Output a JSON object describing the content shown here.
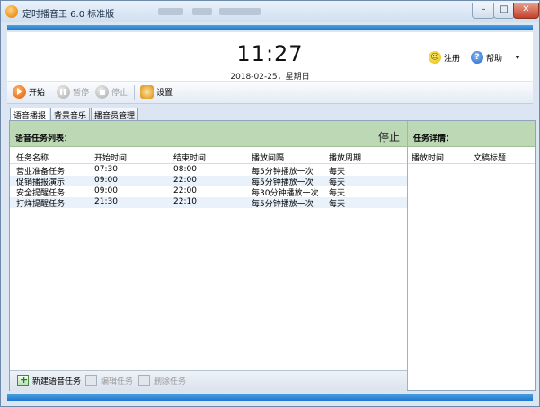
{
  "window": {
    "title": "定时播音王 6.0 标准版",
    "controls": {
      "minimize": "–",
      "maximize": "□",
      "close": "✕"
    }
  },
  "header": {
    "time": "11:27",
    "date": "2018-02-25，星期日",
    "register_label": "注册",
    "help_label": "帮助"
  },
  "toolbar": {
    "start_label": "开始",
    "pause_label": "暂停",
    "stop_label": "停止",
    "settings_label": "设置"
  },
  "tabs": [
    {
      "label": "语音播报",
      "active": true
    },
    {
      "label": "背景音乐",
      "active": false
    },
    {
      "label": "播音员管理",
      "active": false
    }
  ],
  "task_list": {
    "title": "语音任务列表：",
    "status": "停止",
    "columns": [
      "任务名称",
      "开始时间",
      "结束时间",
      "播放间隔",
      "播放周期"
    ],
    "rows": [
      {
        "name": "营业准备任务",
        "start": "07:30",
        "end": "08:00",
        "interval": "每5分钟播放一次",
        "period": "每天"
      },
      {
        "name": "促销播报演示",
        "start": "09:00",
        "end": "22:00",
        "interval": "每5分钟播放一次",
        "period": "每天"
      },
      {
        "name": "安全提醒任务",
        "start": "09:00",
        "end": "22:00",
        "interval": "每30分钟播放一次",
        "period": "每天"
      },
      {
        "name": "打烊提醒任务",
        "start": "21:30",
        "end": "22:10",
        "interval": "每5分钟播放一次",
        "period": "每天"
      }
    ],
    "actions": {
      "new_label": "新建语音任务",
      "edit_label": "编辑任务",
      "delete_label": "删除任务"
    }
  },
  "task_detail": {
    "title": "任务详情：",
    "columns": [
      "播放时间",
      "文稿标题"
    ]
  }
}
